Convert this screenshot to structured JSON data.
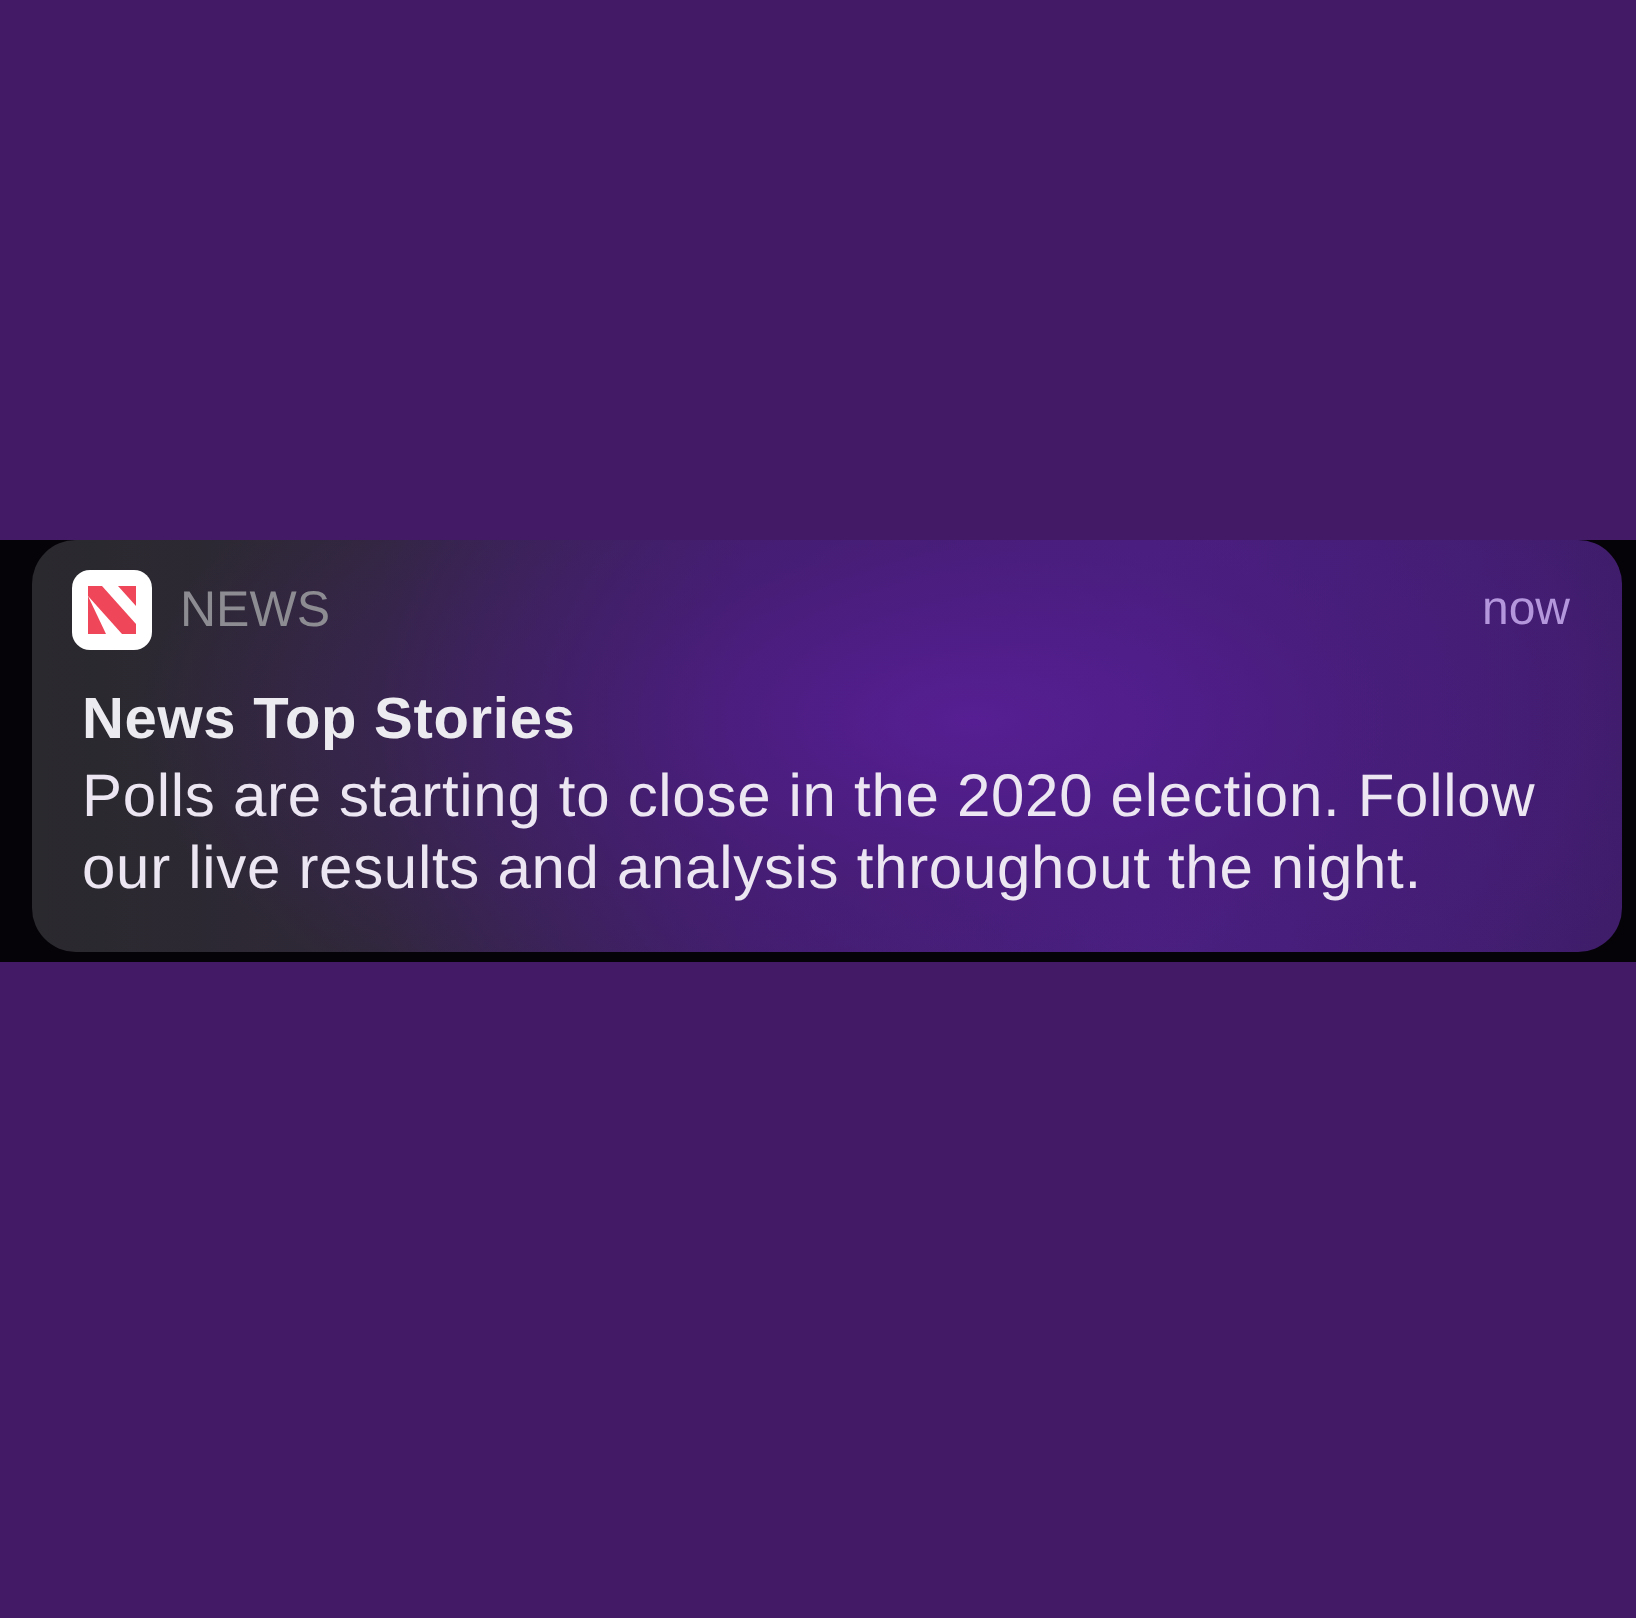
{
  "notification": {
    "app_name": "NEWS",
    "time": "now",
    "title": "News Top Stories",
    "body": "Polls are starting to close in the 2020 election. Follow our live results and analysis throughout the night."
  }
}
